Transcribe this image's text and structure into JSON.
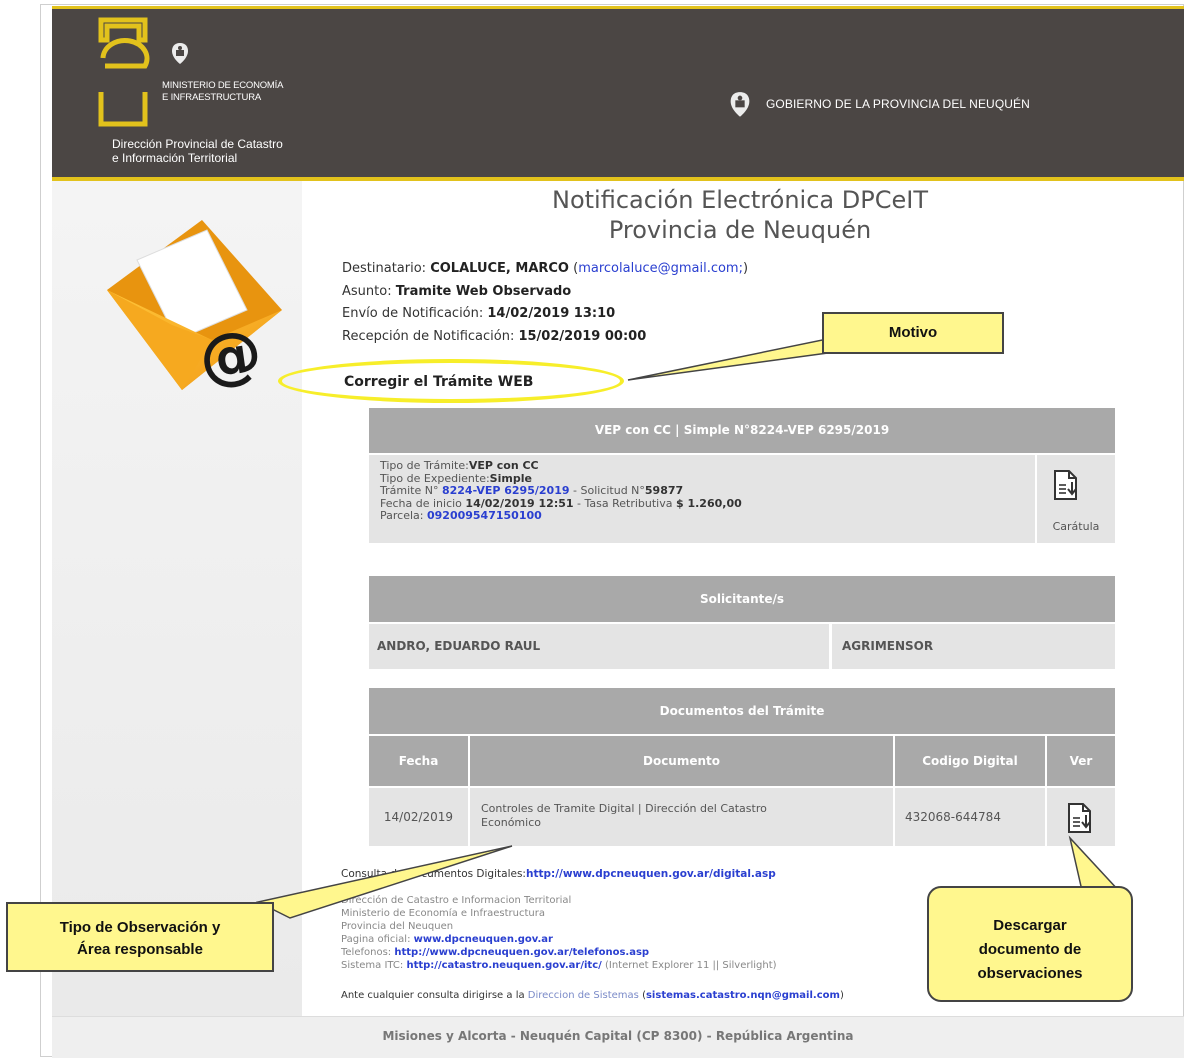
{
  "header": {
    "logo_text": "neu",
    "ministerio_line1": "MINISTERIO DE ECONOMÍA",
    "ministerio_line2": "E INFRAESTRUCTURA",
    "direccion_line1": "Dirección Provincial de Catastro",
    "direccion_line2": "e Información Territorial",
    "gobierno": "GOBIERNO DE LA PROVINCIA DEL NEUQUÉN"
  },
  "title": {
    "line1": "Notificación Electrónica DPCeIT",
    "line2": "Provincia de Neuquén"
  },
  "notification": {
    "destinatario_label": "Destinatario: ",
    "destinatario_value": "COLALUCE, MARCO",
    "destinatario_email": "marcolaluce@gmail.com;",
    "asunto_label": "Asunto: ",
    "asunto_value": "Tramite Web Observado",
    "envio_label": "Envío de Notificación: ",
    "envio_value": "14/02/2019 13:10",
    "recepcion_label": "Recepción de Notificación: ",
    "recepcion_value": "15/02/2019 00:00",
    "motivo": "Corregir el Trámite WEB"
  },
  "tramite": {
    "header": "VEP con CC | Simple N°8224-VEP 6295/2019",
    "tipo_tramite_label": "Tipo de Trámite:",
    "tipo_tramite_value": "VEP con CC",
    "tipo_expediente_label": "Tipo de Expediente:",
    "tipo_expediente_value": "Simple",
    "tramite_label": "Trámite N° ",
    "tramite_value": "8224-VEP 6295/2019",
    "solicitud_label": " - Solicitud N°",
    "solicitud_value": "59877",
    "fecha_label": "Fecha de inicio ",
    "fecha_value": "14/02/2019 12:51",
    "tasa_label": " - Tasa Retributiva ",
    "tasa_value": "$ 1.260,00",
    "parcela_label": "Parcela: ",
    "parcela_value": "092009547150100",
    "caratula_label": "Carátula"
  },
  "solicitantes": {
    "header": "Solicitante/s",
    "name": "ANDRO, EDUARDO RAUL",
    "role": "AGRIMENSOR"
  },
  "documentos": {
    "header": "Documentos del Trámite",
    "columns": [
      "Fecha",
      "Documento",
      "Codigo Digital",
      "Ver"
    ],
    "row": {
      "fecha": "14/02/2019",
      "documento_line1": "Controles de Tramite Digital | Dirección del Catastro",
      "documento_line2": "Económico",
      "codigo": "432068-644784"
    }
  },
  "footer": {
    "consulta_label": "Consulta de Documentos Digitales:",
    "consulta_url": "http://www.dpcneuquen.gov.ar/digital.asp",
    "line1": "Dirección de Catastro e Informacion Territorial",
    "line2": "Ministerio de Economía e Infraestructura",
    "line3": "Provincia del Neuquen",
    "pagina_label": "Pagina oficial: ",
    "pagina_url": "www.dpcneuquen.gov.ar",
    "telefonos_label": "Telefonos: ",
    "telefonos_url": "http://www.dpcneuquen.gov.ar/telefonos.asp",
    "itc_label": "Sistema ITC: ",
    "itc_url": "http://catastro.neuquen.gov.ar/itc/",
    "itc_note": " (Internet Explorer 11 || Silverlight)",
    "ante_label": "Ante cualquier consulta dirigirse a la ",
    "ante_dir": "Direccion de Sistemas",
    "ante_email": "sistemas.catastro.nqn@gmail.com",
    "address": "Misiones y Alcorta - Neuquén Capital (CP 8300) - República Argentina"
  },
  "callouts": {
    "motivo": "Motivo",
    "tipo_line1": "Tipo de Observación y",
    "tipo_line2": "Área responsable",
    "descargar_line1": "Descargar",
    "descargar_line2": "documento de",
    "descargar_line3": "observaciones"
  },
  "colors": {
    "header_bg": "#4b4644",
    "accent_yellow": "#e2c21c",
    "table_header": "#a9a9a9",
    "table_cell": "#e4e4e4",
    "link_blue": "#2a3fd0",
    "callout_fill": "#fff78e"
  }
}
